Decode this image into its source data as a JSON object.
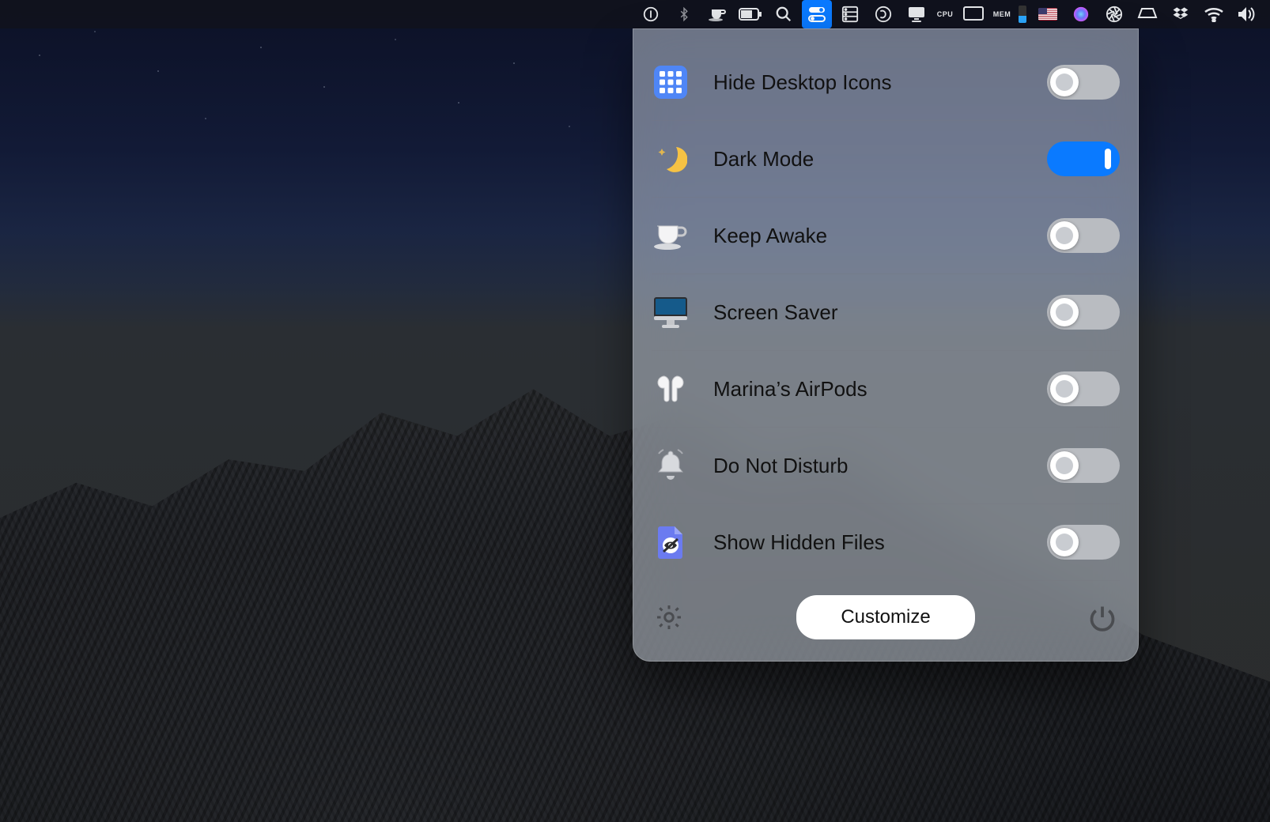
{
  "menubar": {
    "items": [
      {
        "name": "one-password-icon"
      },
      {
        "name": "bluetooth-icon"
      },
      {
        "name": "caffeine-icon"
      },
      {
        "name": "battery-icon"
      },
      {
        "name": "spotlight-icon"
      },
      {
        "name": "one-switch-icon",
        "active": true
      },
      {
        "name": "server-icon"
      },
      {
        "name": "screenflow-icon"
      },
      {
        "name": "display-icon"
      },
      {
        "name": "cpu-label",
        "text": "CPU"
      },
      {
        "name": "monitor-icon"
      },
      {
        "name": "mem-label",
        "text": "MEM"
      },
      {
        "name": "mem-bar"
      },
      {
        "name": "flag-icon"
      },
      {
        "name": "siri-icon"
      },
      {
        "name": "aperture-icon"
      },
      {
        "name": "keyboard-icon"
      },
      {
        "name": "dropbox-icon"
      },
      {
        "name": "wifi-icon"
      },
      {
        "name": "volume-icon"
      }
    ]
  },
  "panel": {
    "rows": [
      {
        "key": "hide_desktop",
        "label": "Hide Desktop Icons",
        "on": false
      },
      {
        "key": "dark_mode",
        "label": "Dark Mode",
        "on": true
      },
      {
        "key": "keep_awake",
        "label": "Keep Awake",
        "on": false
      },
      {
        "key": "screen_saver",
        "label": "Screen Saver",
        "on": false
      },
      {
        "key": "airpods",
        "label": "Marina’s AirPods",
        "on": false
      },
      {
        "key": "dnd",
        "label": "Do Not Disturb",
        "on": false
      },
      {
        "key": "hidden_files",
        "label": "Show Hidden Files",
        "on": false
      }
    ],
    "footer": {
      "customize_label": "Customize"
    }
  }
}
